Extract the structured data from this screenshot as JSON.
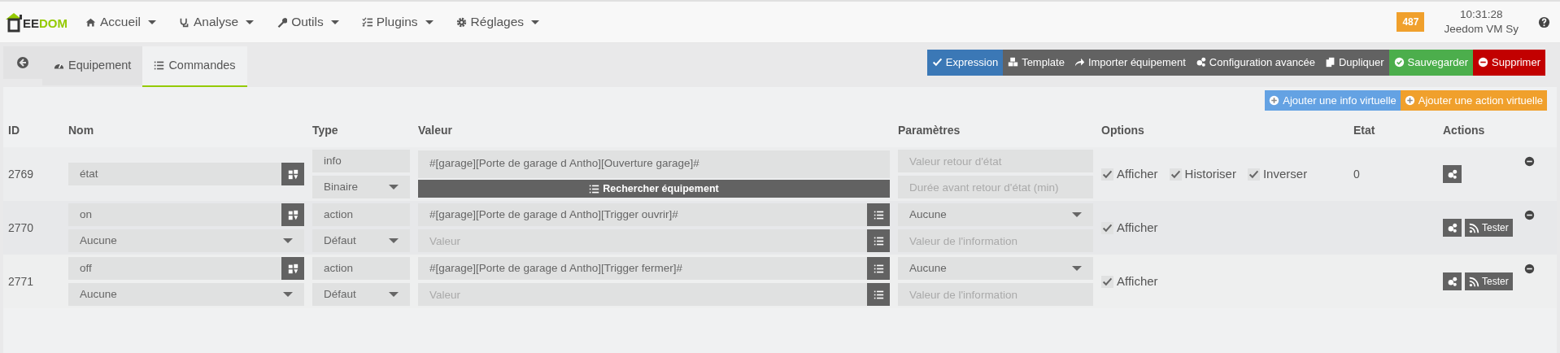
{
  "brand": {
    "part_1": "EE",
    "part_2": "DOM"
  },
  "menu": [
    {
      "label": "Accueil"
    },
    {
      "label": "Analyse"
    },
    {
      "label": "Outils"
    },
    {
      "label": "Plugins"
    },
    {
      "label": "Réglages"
    }
  ],
  "badge": "487",
  "clock": "10:31:28",
  "system": "Jeedom VM Sy",
  "tabs": [
    {
      "kind": "back",
      "selected": false
    },
    {
      "kind": "tab",
      "label": "Equipement",
      "selected": false
    },
    {
      "kind": "tab",
      "label": "Commandes",
      "selected": true
    }
  ],
  "toolbar": [
    {
      "label": "Expression"
    },
    {
      "label": "Template"
    },
    {
      "label": "Importer équipement"
    },
    {
      "label": "Configuration avancée"
    },
    {
      "label": "Dupliquer"
    },
    {
      "label": "Sauvegarder"
    },
    {
      "label": "Supprimer"
    }
  ],
  "add_buttons": [
    {
      "label": "Ajouter une info virtuelle"
    },
    {
      "label": "Ajouter une action virtuelle"
    }
  ],
  "columns": [
    "ID",
    "Nom",
    "Type",
    "Valeur",
    "Paramètres",
    "Options",
    "Etat",
    "Actions"
  ],
  "commands": [
    {
      "kind": "info",
      "id": "2769",
      "name": "état",
      "type": "info",
      "subtype": "Binaire",
      "value": "#[garage][Porte de garage d Antho][Ouverture garage]#",
      "search_button": "Rechercher équipement",
      "param_1": {
        "placeholder": "Valeur retour d'état"
      },
      "param_2": {
        "placeholder": "Durée avant retour d'état (min)"
      },
      "options": [
        {
          "label": "Afficher",
          "checked": true
        },
        {
          "label": "Historiser",
          "checked": true
        },
        {
          "label": "Inverser",
          "checked": true
        }
      ],
      "state": "0"
    },
    {
      "kind": "action",
      "id": "2770",
      "name": "on",
      "generic_type": "Aucune",
      "type": "action",
      "subtype": "Défaut",
      "value": "#[garage][Porte de garage d Antho][Trigger ouvrir]#",
      "value_2": {
        "placeholder": "Valeur"
      },
      "param_1": {
        "value": "Aucune"
      },
      "param_2": {
        "placeholder": "Valeur de l'information"
      },
      "options": [
        {
          "label": "Afficher",
          "checked": true
        }
      ],
      "test_button": "Tester"
    },
    {
      "kind": "action",
      "id": "2771",
      "name": "off",
      "generic_type": "Aucune",
      "type": "action",
      "subtype": "Défaut",
      "value": "#[garage][Porte de garage d Antho][Trigger fermer]#",
      "value_2": {
        "placeholder": "Valeur"
      },
      "param_1": {
        "value": "Aucune"
      },
      "param_2": {
        "placeholder": "Valeur de l'information"
      },
      "options": [
        {
          "label": "Afficher",
          "checked": true
        }
      ],
      "test_button": "Tester"
    }
  ]
}
